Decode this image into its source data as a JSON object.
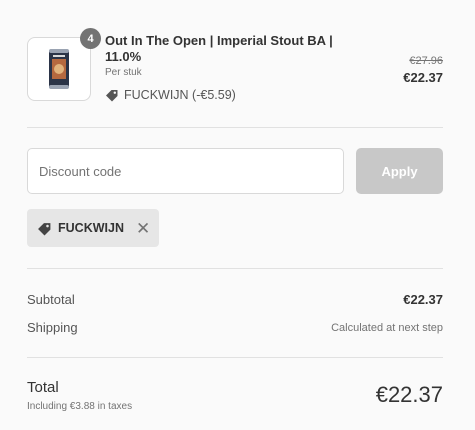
{
  "product": {
    "quantity": "4",
    "title": "Out In The Open | Imperial Stout BA | 11.0%",
    "unit": "Per stuk",
    "discount": "FUCKWIJN (-€5.59)",
    "discount_icon": "tag-icon",
    "price_original": "€27.96",
    "price_final": "€22.37"
  },
  "discount_form": {
    "placeholder": "Discount code",
    "value": "",
    "apply_label": "Apply"
  },
  "applied_code": {
    "code": "FUCKWIJN",
    "icon": "tag-icon",
    "remove_glyph": "✕"
  },
  "summary": {
    "subtotal_label": "Subtotal",
    "subtotal_value": "€22.37",
    "shipping_label": "Shipping",
    "shipping_value": "Calculated at next step",
    "total_label": "Total",
    "tax_note": "Including €3.88 in taxes",
    "total_value": "€22.37"
  },
  "colors": {
    "background": "#fafafa",
    "apply_disabled": "#c8c8c8",
    "tag_background": "#e6e6e6",
    "badge": "#737373"
  }
}
